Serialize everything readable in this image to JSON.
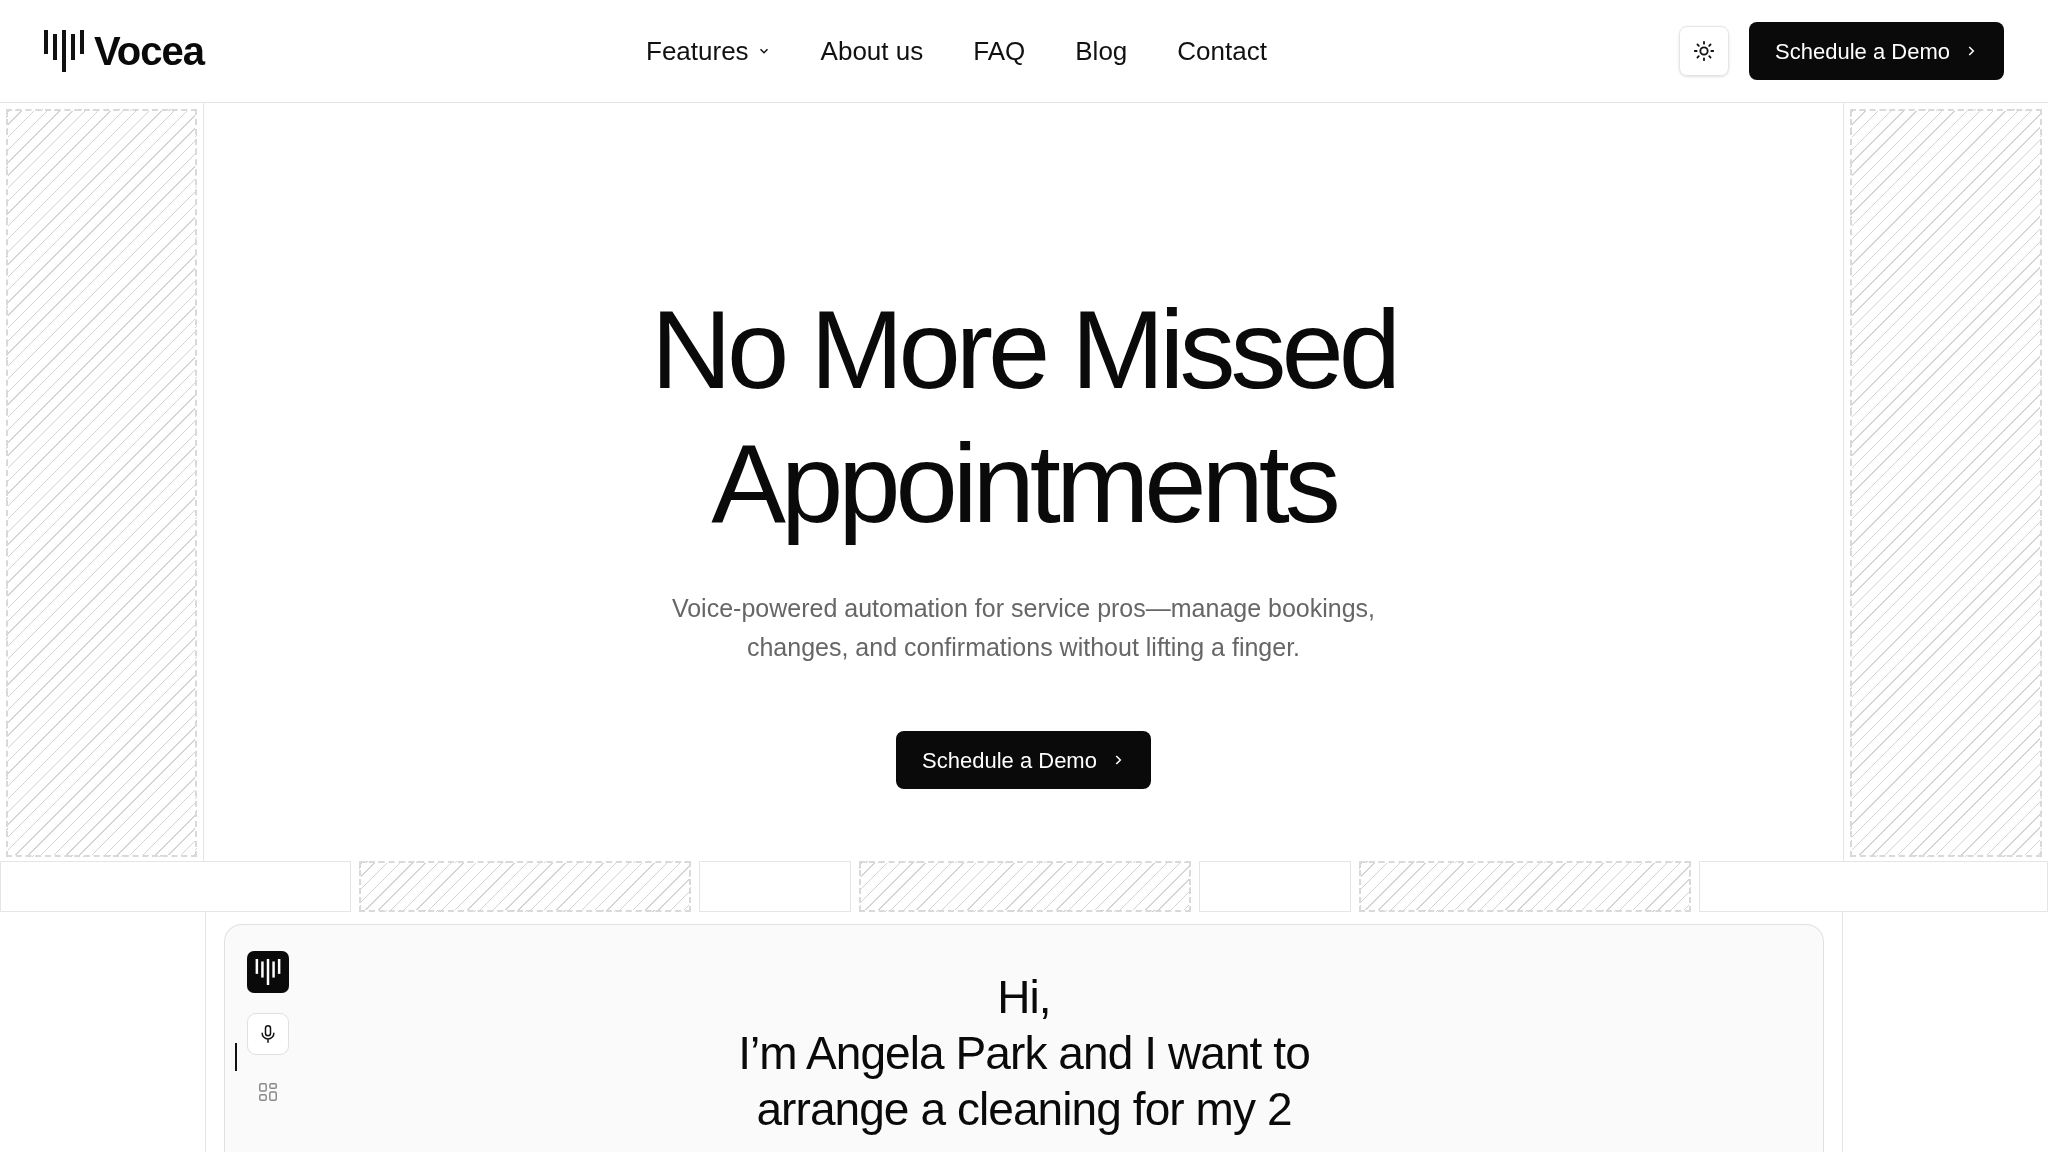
{
  "header": {
    "brand": "Vocea",
    "nav": [
      {
        "label": "Features",
        "dropdown": true
      },
      {
        "label": "About us",
        "dropdown": false
      },
      {
        "label": "FAQ",
        "dropdown": false
      },
      {
        "label": "Blog",
        "dropdown": false
      },
      {
        "label": "Contact",
        "dropdown": false
      }
    ],
    "cta": "Schedule a Demo"
  },
  "hero": {
    "title_lines": [
      "No More Missed",
      "Appointments"
    ],
    "subtitle_lines": [
      "Voice-powered automation for service pros—manage bookings,",
      "changes, and confirmations without lifting a finger."
    ],
    "cta": "Schedule a Demo"
  },
  "demo": {
    "message_lines": [
      "Hi,",
      "I’m Angela Park and I want to",
      "arrange a cleaning for my 2"
    ]
  }
}
